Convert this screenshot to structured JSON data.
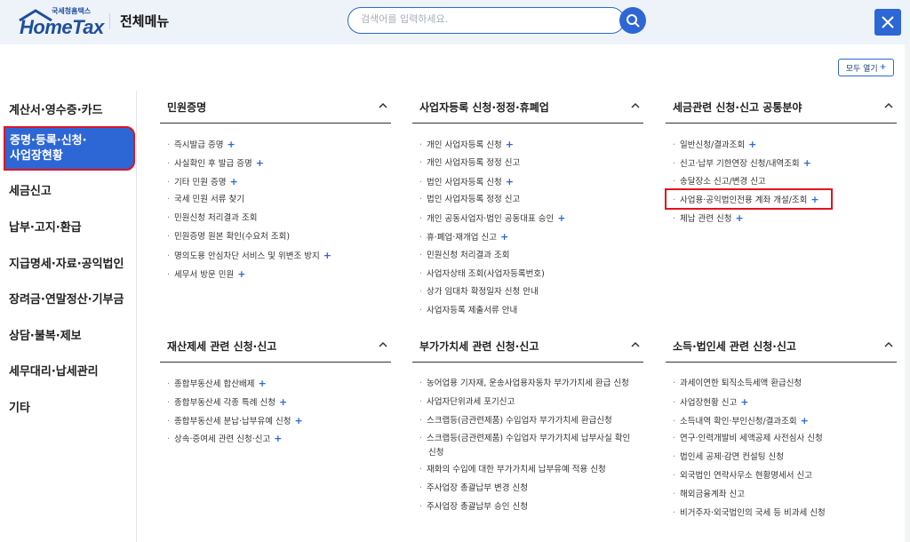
{
  "header": {
    "logo_small": "국세청홈택스",
    "logo_main": "HomeTax",
    "title": "전체메뉴",
    "search_placeholder": "검색어를 입력하세요.",
    "accent_color": "#2d67d6"
  },
  "expand_all": {
    "label": "모두 열기",
    "plus": "+"
  },
  "left_nav": {
    "items": [
      {
        "label": "계산서·영수증·카드"
      },
      {
        "label": "증명·등록·신청·사업장현황",
        "line1": "증명·등록·신청·",
        "line2": "사업장현황",
        "active": true
      },
      {
        "label": "세금신고"
      },
      {
        "label": "납부·고지·환급"
      },
      {
        "label": "지급명세·자료·공익법인"
      },
      {
        "label": "장려금·연말정산·기부금"
      },
      {
        "label": "상담·불복·제보"
      },
      {
        "label": "세무대리·납세관리"
      },
      {
        "label": "기타"
      }
    ]
  },
  "sections": [
    {
      "title": "민원증명",
      "items": [
        {
          "label": "즉시발급 증명",
          "plus": "+"
        },
        {
          "label": "사실확인 후 발급 증명",
          "plus": "+"
        },
        {
          "label": "기타 민원 증명",
          "plus": "+"
        },
        {
          "label": "국세 민원 서류 찾기",
          "plus": ""
        },
        {
          "label": "민원신청 처리결과 조회",
          "plus": ""
        },
        {
          "label": "민원증명 원본 확인(수요처 조회)",
          "plus": ""
        },
        {
          "label": "명의도용 안심차단 서비스 및 위변조 방지",
          "plus": "+"
        },
        {
          "label": "세무서 방문 민원",
          "plus": "+"
        }
      ]
    },
    {
      "title": "사업자등록 신청·정정·휴폐업",
      "items": [
        {
          "label": "개인 사업자등록 신청",
          "plus": "+"
        },
        {
          "label": "개인 사업자등록 정정 신고",
          "plus": ""
        },
        {
          "label": "법인 사업자등록 신청",
          "plus": "+"
        },
        {
          "label": "법인 사업자등록 정정 신고",
          "plus": ""
        },
        {
          "label": "개인 공동사업자·법인 공동대표 승인",
          "plus": "+"
        },
        {
          "label": "휴·폐업·재개업 신고",
          "plus": "+"
        },
        {
          "label": "민원신청 처리결과 조회",
          "plus": ""
        },
        {
          "label": "사업자상태 조회(사업자등록번호)",
          "plus": ""
        },
        {
          "label": "상가 임대차 확정일자 신청 안내",
          "plus": ""
        },
        {
          "label": "사업자등록 제출서류 안내",
          "plus": ""
        }
      ]
    },
    {
      "title": "세금관련 신청·신고 공통분야",
      "items": [
        {
          "label": "일반신청/결과조회",
          "plus": "+"
        },
        {
          "label": "신고·납부 기한연장 신청/내역조회",
          "plus": "+"
        },
        {
          "label": "송달장소 신고/변경 신고",
          "plus": ""
        },
        {
          "label": "사업용·공익법인전용 계좌 개설/조회",
          "plus": "+"
        },
        {
          "label": "체납 관련 신청",
          "plus": "+"
        }
      ]
    },
    {
      "title": "재산제세 관련 신청·신고",
      "items": [
        {
          "label": "종합부동산세 합산배제",
          "plus": "+"
        },
        {
          "label": "종합부동산세 각종 특례 신청",
          "plus": "+"
        },
        {
          "label": "종합부동산세 분납·납부유예 신청",
          "plus": "+"
        },
        {
          "label": "상속·증여세 관련 신청·신고",
          "plus": "+"
        }
      ]
    },
    {
      "title": "부가가치세 관련 신청·신고",
      "items": [
        {
          "label": "농어업용 기자재, 운송사업용자동차 부가가치세 환급 신청",
          "plus": ""
        },
        {
          "label": "사업자단위과세 포기신고",
          "plus": ""
        },
        {
          "label": "스크랩등(금관련제품) 수입업자 부가가치세 환급신청",
          "plus": ""
        },
        {
          "label": "스크랩등(금관련제품) 수입업자 부가가치세 납부사실 확인신청",
          "plus": ""
        },
        {
          "label": "재화의 수입에 대한 부가가치세 납부유예 적용 신청",
          "plus": ""
        },
        {
          "label": "주사업장 총괄납부 변경 신청",
          "plus": ""
        },
        {
          "label": "주사업장 총괄납부 승인 신청",
          "plus": ""
        }
      ]
    },
    {
      "title": "소득·법인세 관련 신청·신고",
      "items": [
        {
          "label": "과세이연한 퇴직소득세액 환급신청",
          "plus": ""
        },
        {
          "label": "사업장현황 신고",
          "plus": "+"
        },
        {
          "label": "소득내역 확인·부인신청/결과조회",
          "plus": "+"
        },
        {
          "label": "연구·인력개발비 세액공제 사전심사 신청",
          "plus": ""
        },
        {
          "label": "법인세 공제·감면 컨설팅 신청",
          "plus": ""
        },
        {
          "label": "외국법인 연락사무소 현황명세서 신고",
          "plus": ""
        },
        {
          "label": "해외금융계좌 신고",
          "plus": ""
        },
        {
          "label": "비거주자·외국법인의 국세 등 비과세 신청",
          "plus": ""
        }
      ]
    }
  ]
}
